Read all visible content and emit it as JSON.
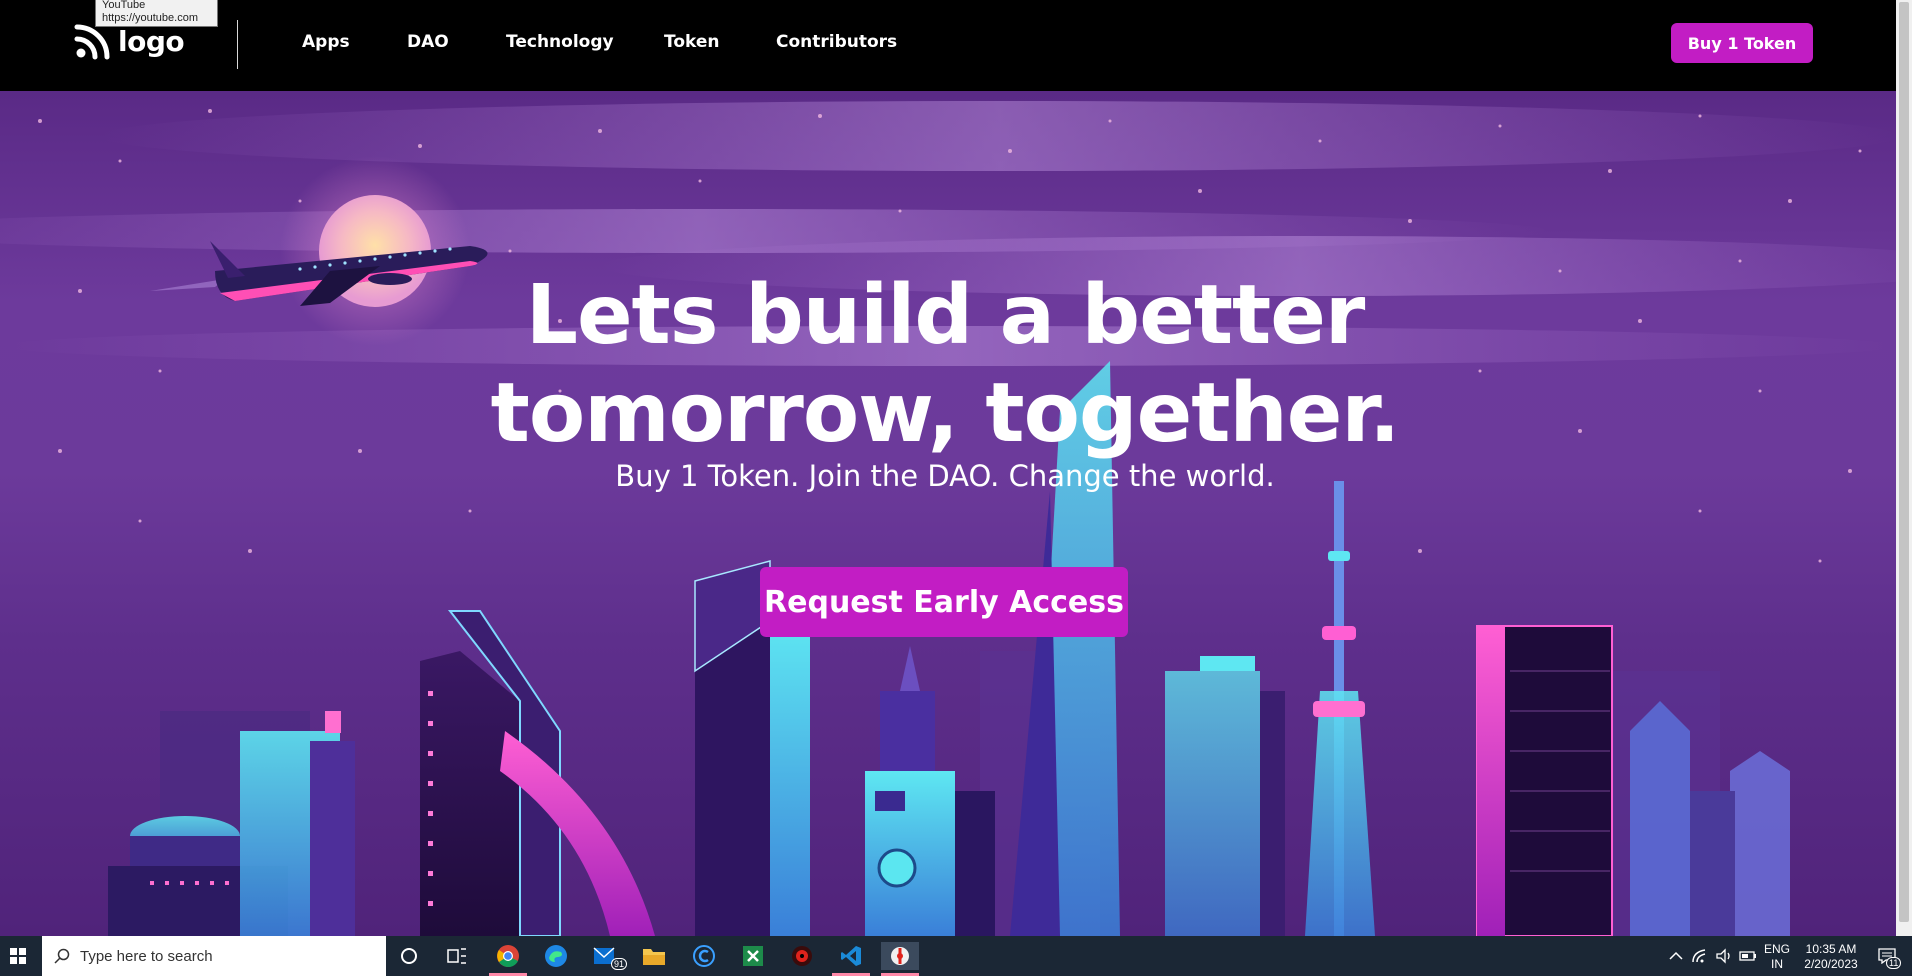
{
  "tooltip": {
    "title": "YouTube",
    "url": "https://youtube.com"
  },
  "navbar": {
    "logo_text": "logo",
    "links": [
      "Apps",
      "DAO",
      "Technology",
      "Token",
      "Contributors"
    ],
    "buy_label": "Buy 1 Token"
  },
  "hero": {
    "headline_line1": "Lets build a better",
    "headline_line2": "tomorrow, together.",
    "subline": "Buy 1 Token. Join the DAO. Change the world.",
    "cta_label": "Request Early Access"
  },
  "colors": {
    "accent": "#c21dc4",
    "navbar_bg": "#000000",
    "hero_purple": "#6c3a9b"
  },
  "taskbar": {
    "search_placeholder": "Type here to search",
    "apps": [
      "cortana-icon",
      "task-view-icon",
      "chrome-icon",
      "edge-icon",
      "mail-icon",
      "file-explorer-icon",
      "c-app-icon",
      "excel-icon",
      "red-app-icon",
      "vscode-icon",
      "figma-app-icon"
    ],
    "mail_badge": "91",
    "lang_line1": "ENG",
    "lang_line2": "IN",
    "time": "10:35 AM",
    "date": "2/20/2023",
    "notification_count": "11"
  }
}
